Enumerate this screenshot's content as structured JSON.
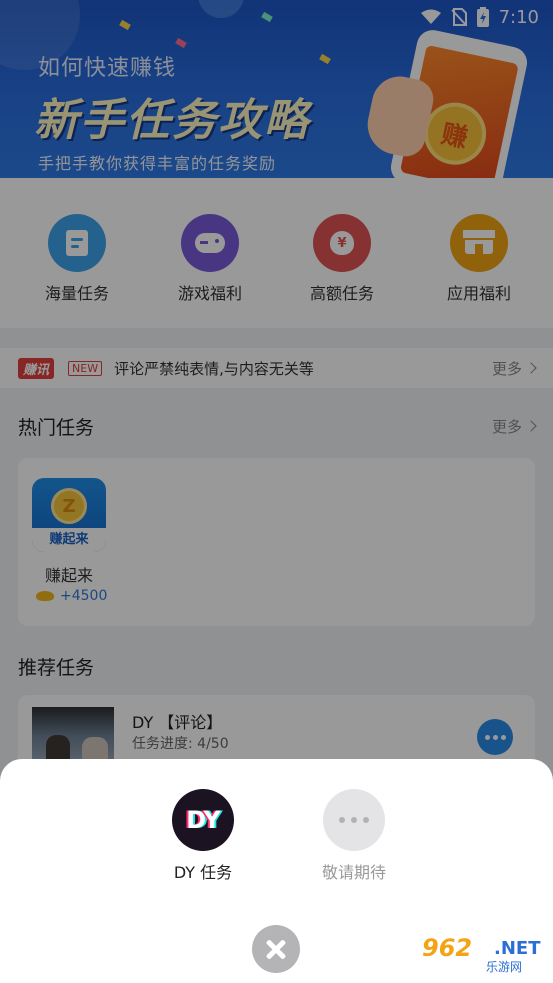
{
  "status_bar": {
    "time": "7:10"
  },
  "banner": {
    "subtitle": "如何快速赚钱",
    "title": "新手任务攻略",
    "description": "手把手教你获得丰富的任务奖励",
    "phone_coin": "赚"
  },
  "categories": [
    {
      "label": "海量任务",
      "icon": "document-icon",
      "color": "#3da4ec"
    },
    {
      "label": "游戏福利",
      "icon": "gamepad-icon",
      "color": "#7b5ad9"
    },
    {
      "label": "高额任务",
      "icon": "money-bag-icon",
      "color": "#e05454",
      "glyph": "¥"
    },
    {
      "label": "应用福利",
      "icon": "shop-icon",
      "color": "#f0a414"
    }
  ],
  "ticker": {
    "badge": "赚讯",
    "new_tag": "NEW",
    "text": "评论严禁纯表情,与内容无关等",
    "more": "更多"
  },
  "hot_tasks": {
    "title": "热门任务",
    "more": "更多",
    "items": [
      {
        "name": "赚起来",
        "tile_label": "赚起来",
        "coin": "Z",
        "reward": "+4500"
      }
    ]
  },
  "recommended": {
    "title": "推荐任务",
    "items": [
      {
        "title": "DY 【评论】",
        "progress": "任务进度: 4/50"
      }
    ]
  },
  "sheet": {
    "options": [
      {
        "logo": "DY",
        "label": "DY 任务",
        "active": true
      },
      {
        "label": "敬请期待",
        "active": false
      }
    ]
  },
  "watermark": {
    "number": "962",
    "suffix": ".NET",
    "text": "乐游网"
  },
  "colors": {
    "accent_blue": "#2b8be8",
    "banner_blue": "#1e56c8",
    "news_red": "#e0413e",
    "reward_blue": "#2f7bd8"
  }
}
